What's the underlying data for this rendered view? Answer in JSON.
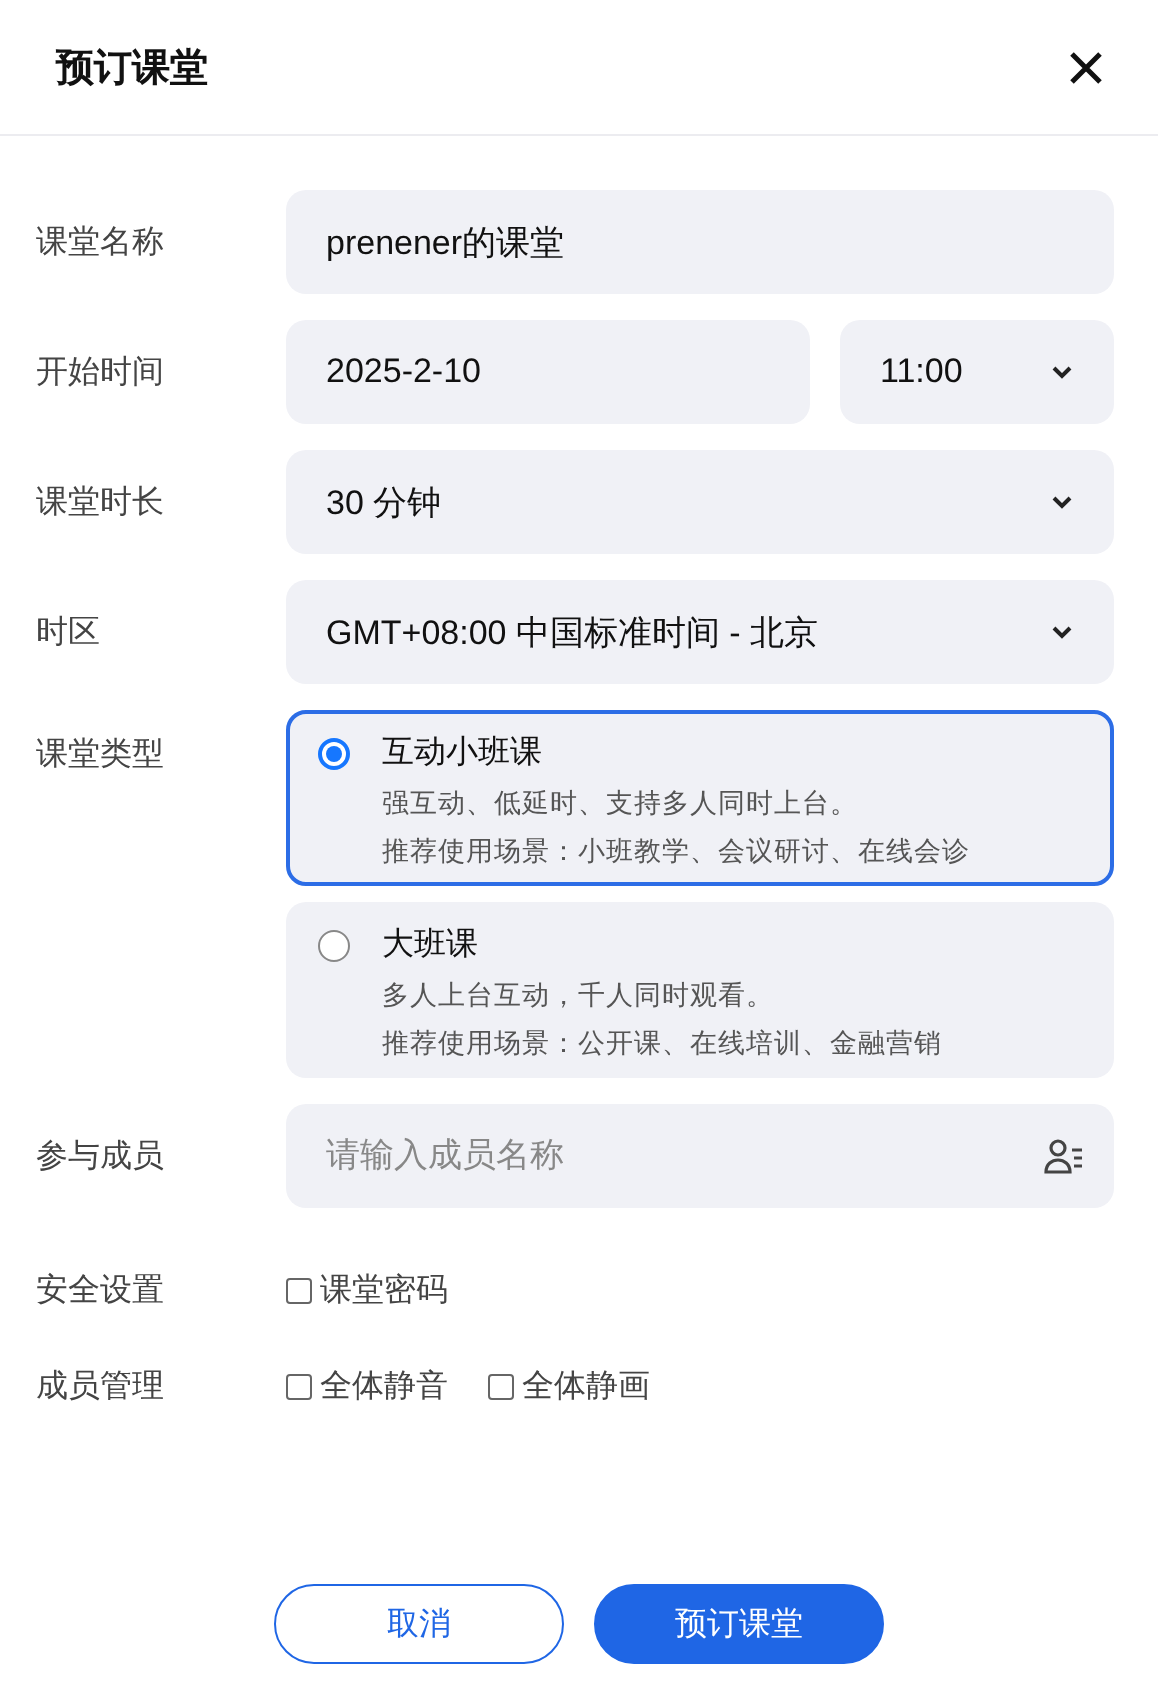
{
  "dialog": {
    "title": "预订课堂"
  },
  "name_field": {
    "label": "课堂名称",
    "value": "prenener的课堂"
  },
  "start_time": {
    "label": "开始时间",
    "date": "2025-2-10",
    "time": "11:00"
  },
  "duration": {
    "label": "课堂时长",
    "value": "30 分钟"
  },
  "timezone": {
    "label": "时区",
    "value": "GMT+08:00 中国标准时间 - 北京"
  },
  "class_type": {
    "label": "课堂类型",
    "options": [
      {
        "title": "互动小班课",
        "description": "强互动、低延时、支持多人同时上台。",
        "scenarios": "推荐使用场景：小班教学、会议研讨、在线会诊",
        "selected": true
      },
      {
        "title": "大班课",
        "description": "多人上台互动，千人同时观看。",
        "scenarios": "推荐使用场景：公开课、在线培训、金融营销",
        "selected": false
      }
    ]
  },
  "members": {
    "label": "参与成员",
    "placeholder": "请输入成员名称"
  },
  "security": {
    "label": "安全设置",
    "options": [
      {
        "label": "课堂密码",
        "checked": false
      }
    ]
  },
  "member_management": {
    "label": "成员管理",
    "options": [
      {
        "label": "全体静音",
        "checked": false
      },
      {
        "label": "全体静画",
        "checked": false
      }
    ]
  },
  "buttons": [
    {
      "label": "取消",
      "kind": "secondary"
    },
    {
      "label": "预订课堂",
      "kind": "primary"
    }
  ]
}
